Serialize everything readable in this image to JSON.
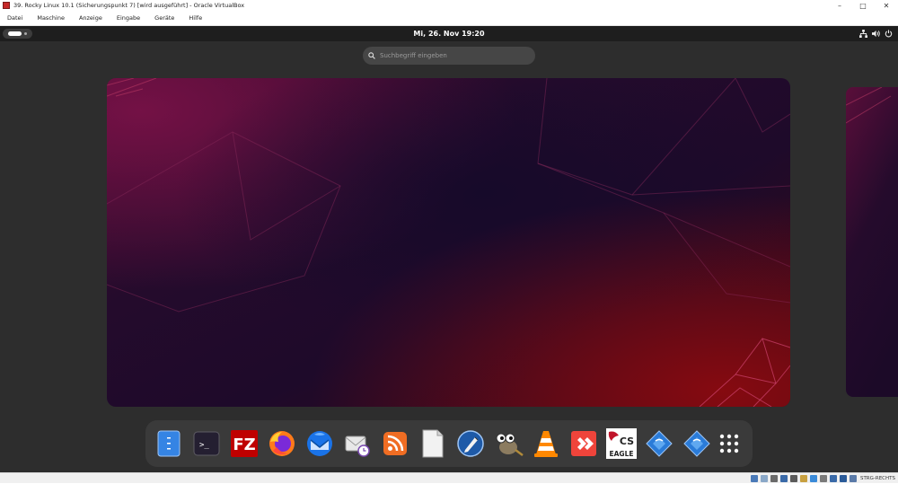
{
  "host_window": {
    "title": "39. Rocky Linux 10.1 (Sicherungspunkt 7) [wird ausgeführt] - Oracle VirtualBox",
    "controls": {
      "minimize": "–",
      "maximize": "□",
      "close": "✕"
    }
  },
  "menubar": {
    "items": [
      "Datei",
      "Maschine",
      "Anzeige",
      "Eingabe",
      "Geräte",
      "Hilfe"
    ]
  },
  "gnome": {
    "clock": "Mi, 26. Nov  19:20",
    "tray_icons": [
      "network-icon",
      "volume-icon",
      "power-icon"
    ],
    "search": {
      "placeholder": "Suchbegriff eingeben",
      "value": ""
    }
  },
  "dash": {
    "apps": [
      {
        "name": "files",
        "icon": "files-icon"
      },
      {
        "name": "terminal",
        "icon": "terminal-icon",
        "glyph": ">_"
      },
      {
        "name": "filezilla",
        "icon": "filezilla-icon",
        "glyph": "FZ"
      },
      {
        "name": "firefox",
        "icon": "firefox-icon"
      },
      {
        "name": "thunderbird",
        "icon": "thunderbird-icon"
      },
      {
        "name": "evolution",
        "icon": "mail-clock-icon"
      },
      {
        "name": "rss-reader",
        "icon": "rss-icon"
      },
      {
        "name": "text-editor",
        "icon": "document-icon"
      },
      {
        "name": "inkscape",
        "icon": "pen-icon"
      },
      {
        "name": "gimp",
        "icon": "gimp-icon"
      },
      {
        "name": "vlc",
        "icon": "vlc-cone-icon"
      },
      {
        "name": "anydesk",
        "icon": "anydesk-icon"
      },
      {
        "name": "eagle",
        "icon": "eagle-icon",
        "glyph_top": "CS",
        "glyph_bottom": "EAGLE"
      },
      {
        "name": "remote-viewer-1",
        "icon": "diamond-app-icon"
      },
      {
        "name": "remote-viewer-2",
        "icon": "diamond-app-icon"
      },
      {
        "name": "show-apps",
        "icon": "app-grid-icon"
      }
    ]
  },
  "statusbar": {
    "host_key": "STRG-RECHTS"
  },
  "colors": {
    "guest_bg": "#2d2d2d",
    "top_bar": "#1e1e1e",
    "dash_bg": "#3a3a3a",
    "wallpaper_dark": "#1a0a2e",
    "wallpaper_magenta": "#6a0f3e",
    "wallpaper_red": "#7a0a12"
  }
}
